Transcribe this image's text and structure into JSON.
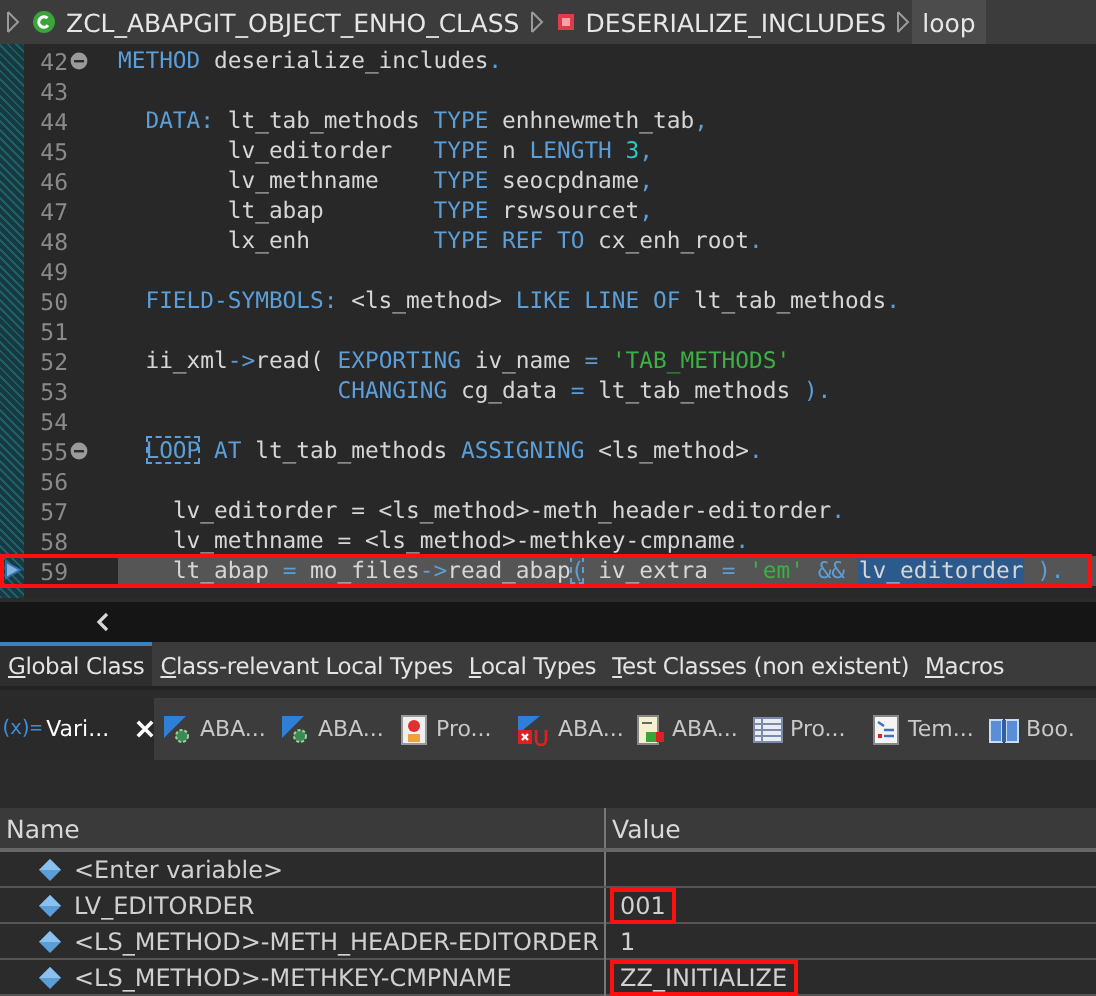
{
  "breadcrumb": [
    {
      "kind": "class",
      "label": "ZCL_ABAPGIT_OBJECT_ENHO_CLASS",
      "selected": false
    },
    {
      "kind": "method",
      "label": "DESERIALIZE_INCLUDES",
      "selected": false
    },
    {
      "kind": "plain",
      "label": "loop",
      "selected": true
    }
  ],
  "code": {
    "lines": [
      {
        "number": "42",
        "fold": true,
        "current": false,
        "marked": false,
        "segments": [
          {
            "kind": "kw",
            "text": "METHOD"
          },
          {
            "kind": "id",
            "text": " deserialize_includes"
          },
          {
            "kind": "punct",
            "text": "."
          }
        ]
      },
      {
        "number": "43",
        "fold": false,
        "current": false,
        "marked": false
      },
      {
        "number": "44",
        "fold": false,
        "current": false,
        "marked": false,
        "segments": [
          {
            "kind": "kw",
            "text": "  DATA:"
          },
          {
            "kind": "id",
            "text": " lt_tab_methods "
          },
          {
            "kind": "kw",
            "text": "TYPE"
          },
          {
            "kind": "id",
            "text": " enhnewmeth_tab"
          },
          {
            "kind": "punct",
            "text": ","
          }
        ]
      },
      {
        "number": "45",
        "fold": false,
        "current": false,
        "marked": false,
        "segments": [
          {
            "kind": "id",
            "text": "        lv_editorder   "
          },
          {
            "kind": "kw",
            "text": "TYPE"
          },
          {
            "kind": "id",
            "text": " n "
          },
          {
            "kind": "kw",
            "text": "LENGTH"
          },
          {
            "kind": "num",
            "text": " 3"
          },
          {
            "kind": "punct",
            "text": ","
          }
        ]
      },
      {
        "number": "46",
        "fold": false,
        "current": false,
        "marked": false,
        "segments": [
          {
            "kind": "id",
            "text": "        lv_methname    "
          },
          {
            "kind": "kw",
            "text": "TYPE"
          },
          {
            "kind": "id",
            "text": " seocpdname"
          },
          {
            "kind": "punct",
            "text": ","
          }
        ]
      },
      {
        "number": "47",
        "fold": false,
        "current": false,
        "marked": false,
        "segments": [
          {
            "kind": "id",
            "text": "        lt_abap        "
          },
          {
            "kind": "kw",
            "text": "TYPE"
          },
          {
            "kind": "id",
            "text": " rswsourcet"
          },
          {
            "kind": "punct",
            "text": ","
          }
        ]
      },
      {
        "number": "48",
        "fold": false,
        "current": false,
        "marked": false,
        "segments": [
          {
            "kind": "id",
            "text": "        lx_enh         "
          },
          {
            "kind": "kw",
            "text": "TYPE REF TO"
          },
          {
            "kind": "id",
            "text": " cx_enh_root"
          },
          {
            "kind": "punct",
            "text": "."
          }
        ]
      },
      {
        "number": "49",
        "fold": false,
        "current": false,
        "marked": false
      },
      {
        "number": "50",
        "fold": false,
        "current": false,
        "marked": false,
        "segments": [
          {
            "kind": "kw",
            "text": "  FIELD-SYMBOLS:"
          },
          {
            "kind": "id",
            "text": " <ls_method> "
          },
          {
            "kind": "kw",
            "text": "LIKE LINE OF"
          },
          {
            "kind": "id",
            "text": " lt_tab_methods"
          },
          {
            "kind": "punct",
            "text": "."
          }
        ]
      },
      {
        "number": "51",
        "fold": false,
        "current": false,
        "marked": false
      },
      {
        "number": "52",
        "fold": false,
        "current": false,
        "marked": false,
        "segments": [
          {
            "kind": "id",
            "text": "  ii_xml"
          },
          {
            "kind": "punct",
            "text": "->"
          },
          {
            "kind": "id",
            "text": "read( "
          },
          {
            "kind": "kw",
            "text": "EXPORTING"
          },
          {
            "kind": "id",
            "text": " iv_name "
          },
          {
            "kind": "punct",
            "text": "="
          },
          {
            "kind": "str",
            "text": " 'TAB_METHODS'"
          }
        ]
      },
      {
        "number": "53",
        "fold": false,
        "current": false,
        "marked": false,
        "segments": [
          {
            "kind": "kw",
            "text": "                CHANGING"
          },
          {
            "kind": "id",
            "text": " cg_data "
          },
          {
            "kind": "punct",
            "text": "="
          },
          {
            "kind": "id",
            "text": " lt_tab_methods "
          },
          {
            "kind": "punct",
            "text": ")."
          }
        ]
      },
      {
        "number": "54",
        "fold": false,
        "current": false,
        "marked": false
      },
      {
        "number": "55",
        "fold": true,
        "current": false,
        "marked": false,
        "segments": [
          {
            "kind": "match",
            "text": "  LOOP"
          },
          {
            "kind": "kw",
            "text": " AT"
          },
          {
            "kind": "id",
            "text": " lt_tab_methods "
          },
          {
            "kind": "kw",
            "text": "ASSIGNING"
          },
          {
            "kind": "id",
            "text": " <ls_method>"
          },
          {
            "kind": "punct",
            "text": "."
          }
        ]
      },
      {
        "number": "56",
        "fold": false,
        "current": false,
        "marked": false
      },
      {
        "number": "57",
        "fold": false,
        "current": false,
        "marked": false,
        "segments": [
          {
            "kind": "id",
            "text": "    lv_editorder = <ls_method>-meth_header-editorder"
          },
          {
            "kind": "punct",
            "text": "."
          }
        ]
      },
      {
        "number": "58",
        "fold": false,
        "current": false,
        "marked": false,
        "segments": [
          {
            "kind": "id",
            "text": "    lv_methname = <ls_method>-methkey-cmpname"
          },
          {
            "kind": "punct",
            "text": "."
          }
        ]
      },
      {
        "number": "59",
        "fold": false,
        "current": true,
        "marked": true,
        "segments": [
          {
            "kind": "id",
            "text": "    lt_abap "
          },
          {
            "kind": "punct",
            "text": "="
          },
          {
            "kind": "id",
            "text": " mo_files"
          },
          {
            "kind": "punct",
            "text": "->"
          },
          {
            "kind": "id",
            "text": "read_abap"
          },
          {
            "kind": "match",
            "text": "("
          },
          {
            "kind": "id",
            "text": " iv_extra "
          },
          {
            "kind": "punct",
            "text": "="
          },
          {
            "kind": "str",
            "text": " 'em'"
          },
          {
            "kind": "punct",
            "text": " &&"
          },
          {
            "kind": "sel",
            "text": " lv_editorder"
          },
          {
            "kind": "punct",
            "text": " )."
          }
        ]
      }
    ]
  },
  "source_tabs": [
    {
      "label": "Global Class",
      "selected": true
    },
    {
      "label": "Class-relevant Local Types",
      "selected": false
    },
    {
      "label": "Local Types",
      "selected": false
    },
    {
      "label": "Test Classes (non existent)",
      "selected": false
    },
    {
      "label": "Macros",
      "selected": false
    }
  ],
  "views": [
    {
      "kind": "variables",
      "icon": "(x)=",
      "label": "Vari...",
      "selected": true
    },
    {
      "kind": "gear",
      "label": "ABA...",
      "selected": false
    },
    {
      "kind": "gear",
      "label": "ABA...",
      "selected": false
    },
    {
      "kind": "profile",
      "label": "Pro...",
      "selected": false
    },
    {
      "kind": "error",
      "label": "ABA...",
      "selected": false
    },
    {
      "kind": "doc",
      "label": "ABA...",
      "selected": false
    },
    {
      "kind": "table",
      "label": "Pro...",
      "selected": false
    },
    {
      "kind": "template",
      "label": "Tem...",
      "selected": false
    },
    {
      "kind": "book",
      "label": "Boo.",
      "selected": false
    }
  ],
  "variables": {
    "columns": [
      "Name",
      "Value"
    ],
    "rows": [
      {
        "name": "<Enter variable>"
      },
      {
        "name": "LV_EDITORDER",
        "value": "001",
        "marked": true
      },
      {
        "name": "<LS_METHOD>-METH_HEADER-EDITORDER",
        "value": "1",
        "marked": false
      },
      {
        "name": "<LS_METHOD>-METHKEY-CMPNAME",
        "value": "ZZ_INITIALIZE",
        "marked": true
      }
    ]
  }
}
